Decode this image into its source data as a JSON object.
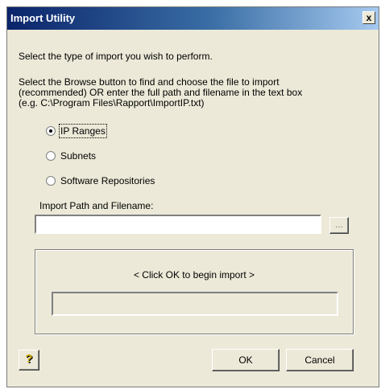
{
  "window": {
    "title": "Import Utility",
    "close_glyph": "x"
  },
  "instructions": {
    "line1": "Select the type of import you wish to perform.",
    "line2": "Select the Browse button to find and choose the file to import",
    "line3": "(recommended)  OR enter the full path and filename in the text box",
    "line4": "(e.g. C:\\Program Files\\Rapport\\ImportIP.txt)"
  },
  "import_types": [
    {
      "label": "IP Ranges",
      "selected": true
    },
    {
      "label": "Subnets",
      "selected": false
    },
    {
      "label": "Software Repositories",
      "selected": false
    }
  ],
  "path": {
    "label": "Import Path and Filename:",
    "value": "",
    "browse_label": "..."
  },
  "status": {
    "message": "< Click OK to begin import >",
    "progress": 0
  },
  "buttons": {
    "help_glyph": "?",
    "ok_label": "OK",
    "cancel_label": "Cancel"
  },
  "colors": {
    "title_start": "#0a246a",
    "title_end": "#a6caf0",
    "face": "#ece9d8"
  }
}
